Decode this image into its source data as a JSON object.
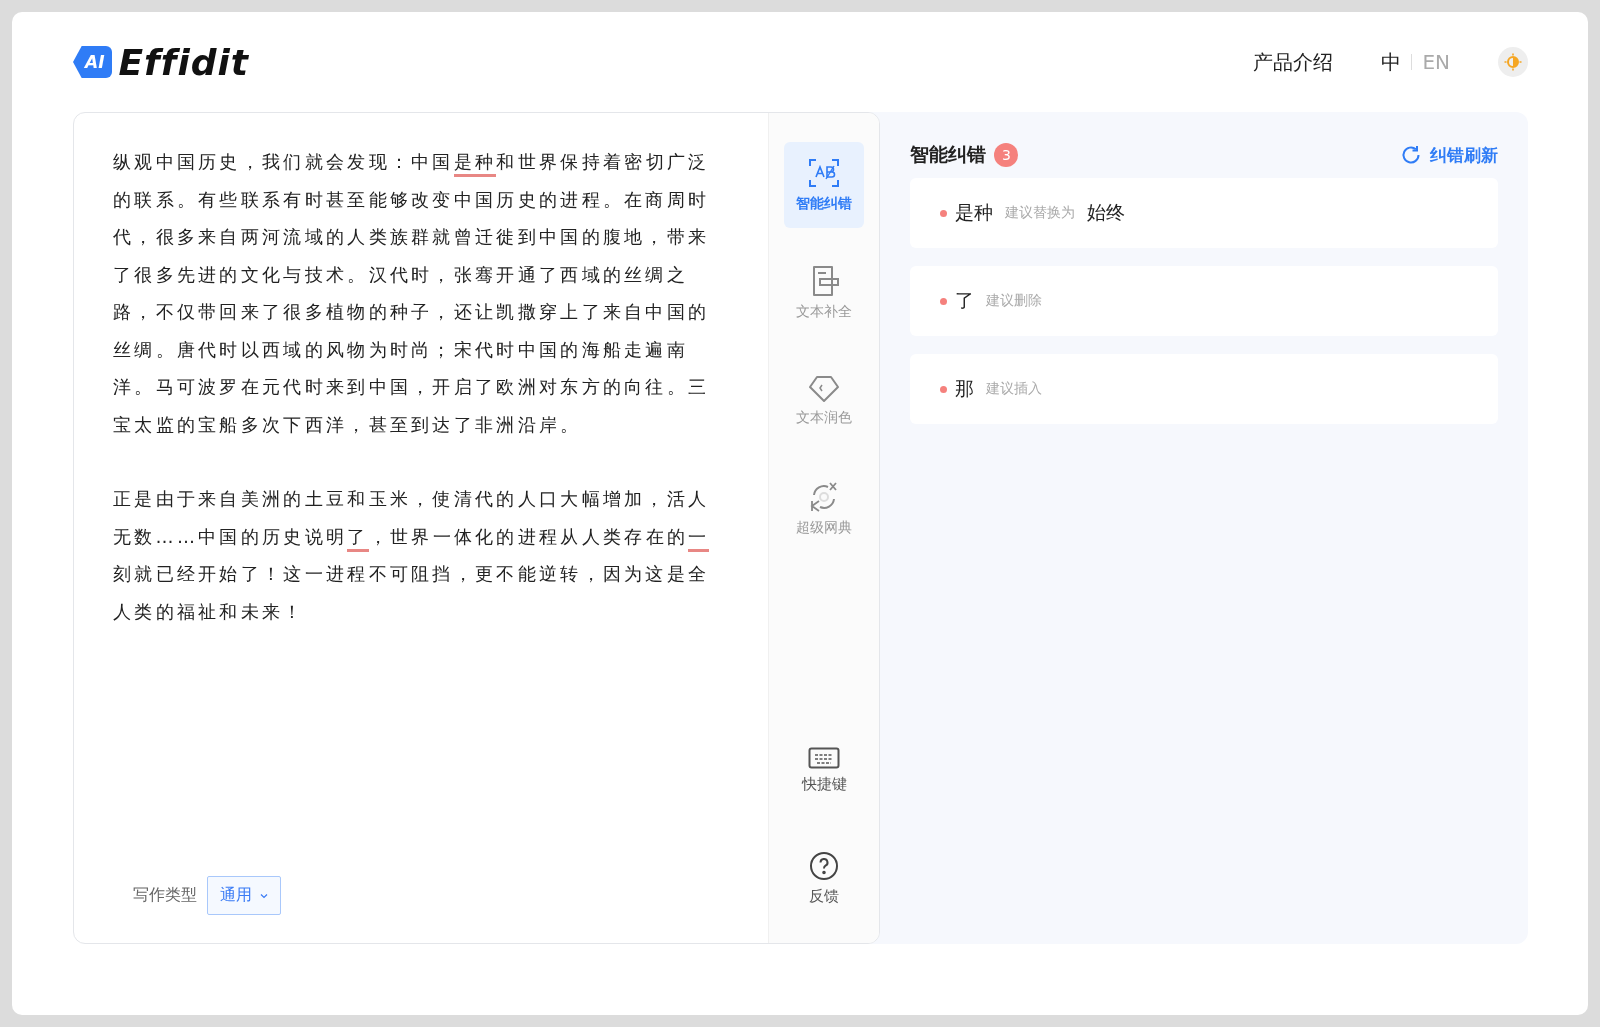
{
  "header": {
    "logo_badge": "AI",
    "logo_text": "Effidit",
    "nav": [
      {
        "label": "产品介绍"
      }
    ],
    "languages": [
      {
        "label": "中",
        "selected": true
      },
      {
        "label": "EN",
        "selected": false
      }
    ]
  },
  "editor": {
    "paragraphs": [
      {
        "segments": [
          {
            "text": "纵观中国历史，我们就会发现：中国",
            "flagged": false
          },
          {
            "text": "是种",
            "flagged": true
          },
          {
            "text": "和世界保持着密切广泛的联系。有些联系有时甚至能够改变中国历史的进程。在商周时代，很多来自两河流域的人类族群就曾迁徙到中国的腹地，带来了很多先进的文化与技术。汉代时，张骞开通了西域的丝绸之路，不仅带回来了很多植物的种子，还让凯撒穿上了来自中国的丝绸。唐代时以西域的风物为时尚；宋代时中国的海船走遍南洋。马可波罗在元代时来到中国，开启了欧洲对东方的向往。三宝太监的宝船多次下西洋，甚至到达了非洲沿岸。",
            "flagged": false
          }
        ]
      },
      {
        "segments": [
          {
            "text": "正是由于来自美洲的土豆和玉米，使清代的人口大幅增加，活人无数……中国的历史说明",
            "flagged": false
          },
          {
            "text": "了",
            "flagged": true
          },
          {
            "text": "，世界一体化的进程从人类存在的",
            "flagged": false
          },
          {
            "text": "一",
            "flagged": true
          },
          {
            "text": "刻就已经开始了！这一进程不可阻挡，更不能逆转，因为这是全人类的福祉和未来！",
            "flagged": false
          }
        ]
      }
    ],
    "writing_type": {
      "label": "写作类型",
      "value": "通用"
    }
  },
  "tools": [
    {
      "label": "智能纠错",
      "kind": "correct",
      "selected": true
    },
    {
      "label": "文本补全",
      "kind": "complete",
      "selected": false
    },
    {
      "label": "文本润色",
      "kind": "polish",
      "selected": false
    },
    {
      "label": "超级网典",
      "kind": "dictionary",
      "selected": false
    }
  ],
  "footer_tools": [
    {
      "label": "快捷键",
      "kind": "keyboard"
    },
    {
      "label": "反馈",
      "kind": "help"
    }
  ],
  "panel": {
    "title": "智能纠错",
    "count": "3",
    "refresh": "纠错刷新",
    "suggestions": [
      {
        "word": "是种",
        "hint": "建议替换为",
        "replacement": "始终"
      },
      {
        "word": "了",
        "hint": "建议删除"
      },
      {
        "word": "那",
        "hint": "建议插入"
      }
    ]
  }
}
